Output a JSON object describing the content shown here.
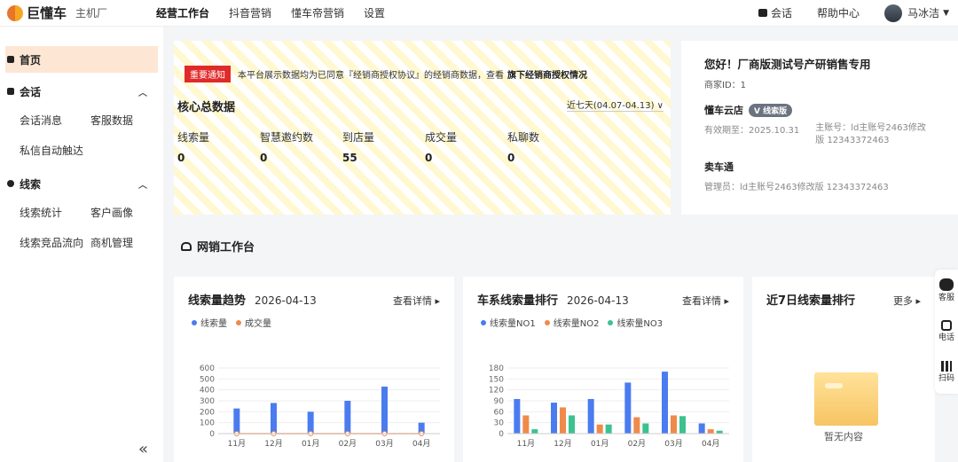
{
  "brand": {
    "name": "巨懂车",
    "sub": "主机厂"
  },
  "nav": {
    "items": [
      "经营工作台",
      "抖音营销",
      "懂车帝营销",
      "设置"
    ],
    "active": 0
  },
  "top_right": {
    "chat": "会话",
    "help": "帮助中心",
    "user": "马冰洁"
  },
  "sidebar": {
    "home": "首页",
    "groups": [
      {
        "label": "会话",
        "items": [
          [
            "会话消息",
            "客服数据"
          ],
          [
            "私信自动触达"
          ]
        ]
      },
      {
        "label": "线索",
        "items": [
          [
            "线索统计",
            "客户画像"
          ],
          [
            "线索竞品流向",
            "商机管理"
          ]
        ]
      }
    ]
  },
  "notice": {
    "tag": "重要通知",
    "text": "本平台展示数据均为已同意『经销商授权协议』的经销商数据，查看",
    "link": "旗下经销商授权情况"
  },
  "core": {
    "title": "核心总数据",
    "date_range": "近七天(04.07-04.13) ∨",
    "metrics": [
      {
        "label": "线索量",
        "value": "0"
      },
      {
        "label": "智慧邀约数",
        "value": "0"
      },
      {
        "label": "到店量",
        "value": "55"
      },
      {
        "label": "成交量",
        "value": "0"
      },
      {
        "label": "私聊数",
        "value": "0"
      }
    ]
  },
  "profile": {
    "greeting": "您好！厂商版测试号产研销售专用",
    "merchant_id": "商家ID：1",
    "store": "懂车云店",
    "store_badge": "V 线索版",
    "expiry": "有效期至：2025.10.31",
    "store_account": "主账号：ld主账号2463修改版 12343372463",
    "product": "卖车通",
    "manager": "管理员：ld主账号2463修改版 12343372463"
  },
  "workbench_title": "网销工作台",
  "panels": {
    "trend": {
      "title": "线索量趋势",
      "date": "2026-04-13",
      "more": "查看详情 ▸"
    },
    "rank": {
      "title": "车系线索量排行",
      "date": "2026-04-13",
      "more": "查看详情 ▸"
    },
    "week": {
      "title": "近7日线索量排行",
      "more": "更多 ▸",
      "empty": "暂无内容"
    }
  },
  "float_bar": {
    "service": "客服",
    "phone": "电话",
    "scan": "扫码"
  },
  "colors": {
    "blue": "#4a7cf0",
    "orange": "#f08a4b",
    "green": "#3cc28f"
  },
  "chart_data": [
    {
      "type": "bar",
      "categories": [
        "11月",
        "12月",
        "01月",
        "02月",
        "03月",
        "04月"
      ],
      "series": [
        {
          "name": "线索量",
          "values": [
            230,
            280,
            200,
            300,
            430,
            100
          ]
        },
        {
          "name": "成交量",
          "values": [
            0,
            0,
            0,
            0,
            0,
            0
          ]
        }
      ],
      "ylim": [
        0,
        600
      ],
      "yticks": [
        0,
        100,
        200,
        300,
        400,
        500,
        600
      ]
    },
    {
      "type": "bar",
      "categories": [
        "11月",
        "12月",
        "01月",
        "02月",
        "03月",
        "04月"
      ],
      "series": [
        {
          "name": "线索量NO1",
          "values": [
            95,
            85,
            95,
            140,
            170,
            28
          ]
        },
        {
          "name": "线索量NO2",
          "values": [
            50,
            72,
            25,
            45,
            50,
            12
          ]
        },
        {
          "name": "线索量NO3",
          "values": [
            12,
            50,
            25,
            28,
            48,
            8
          ]
        }
      ],
      "ylim": [
        0,
        180
      ],
      "yticks": [
        0,
        30,
        60,
        90,
        120,
        150,
        180
      ]
    }
  ]
}
